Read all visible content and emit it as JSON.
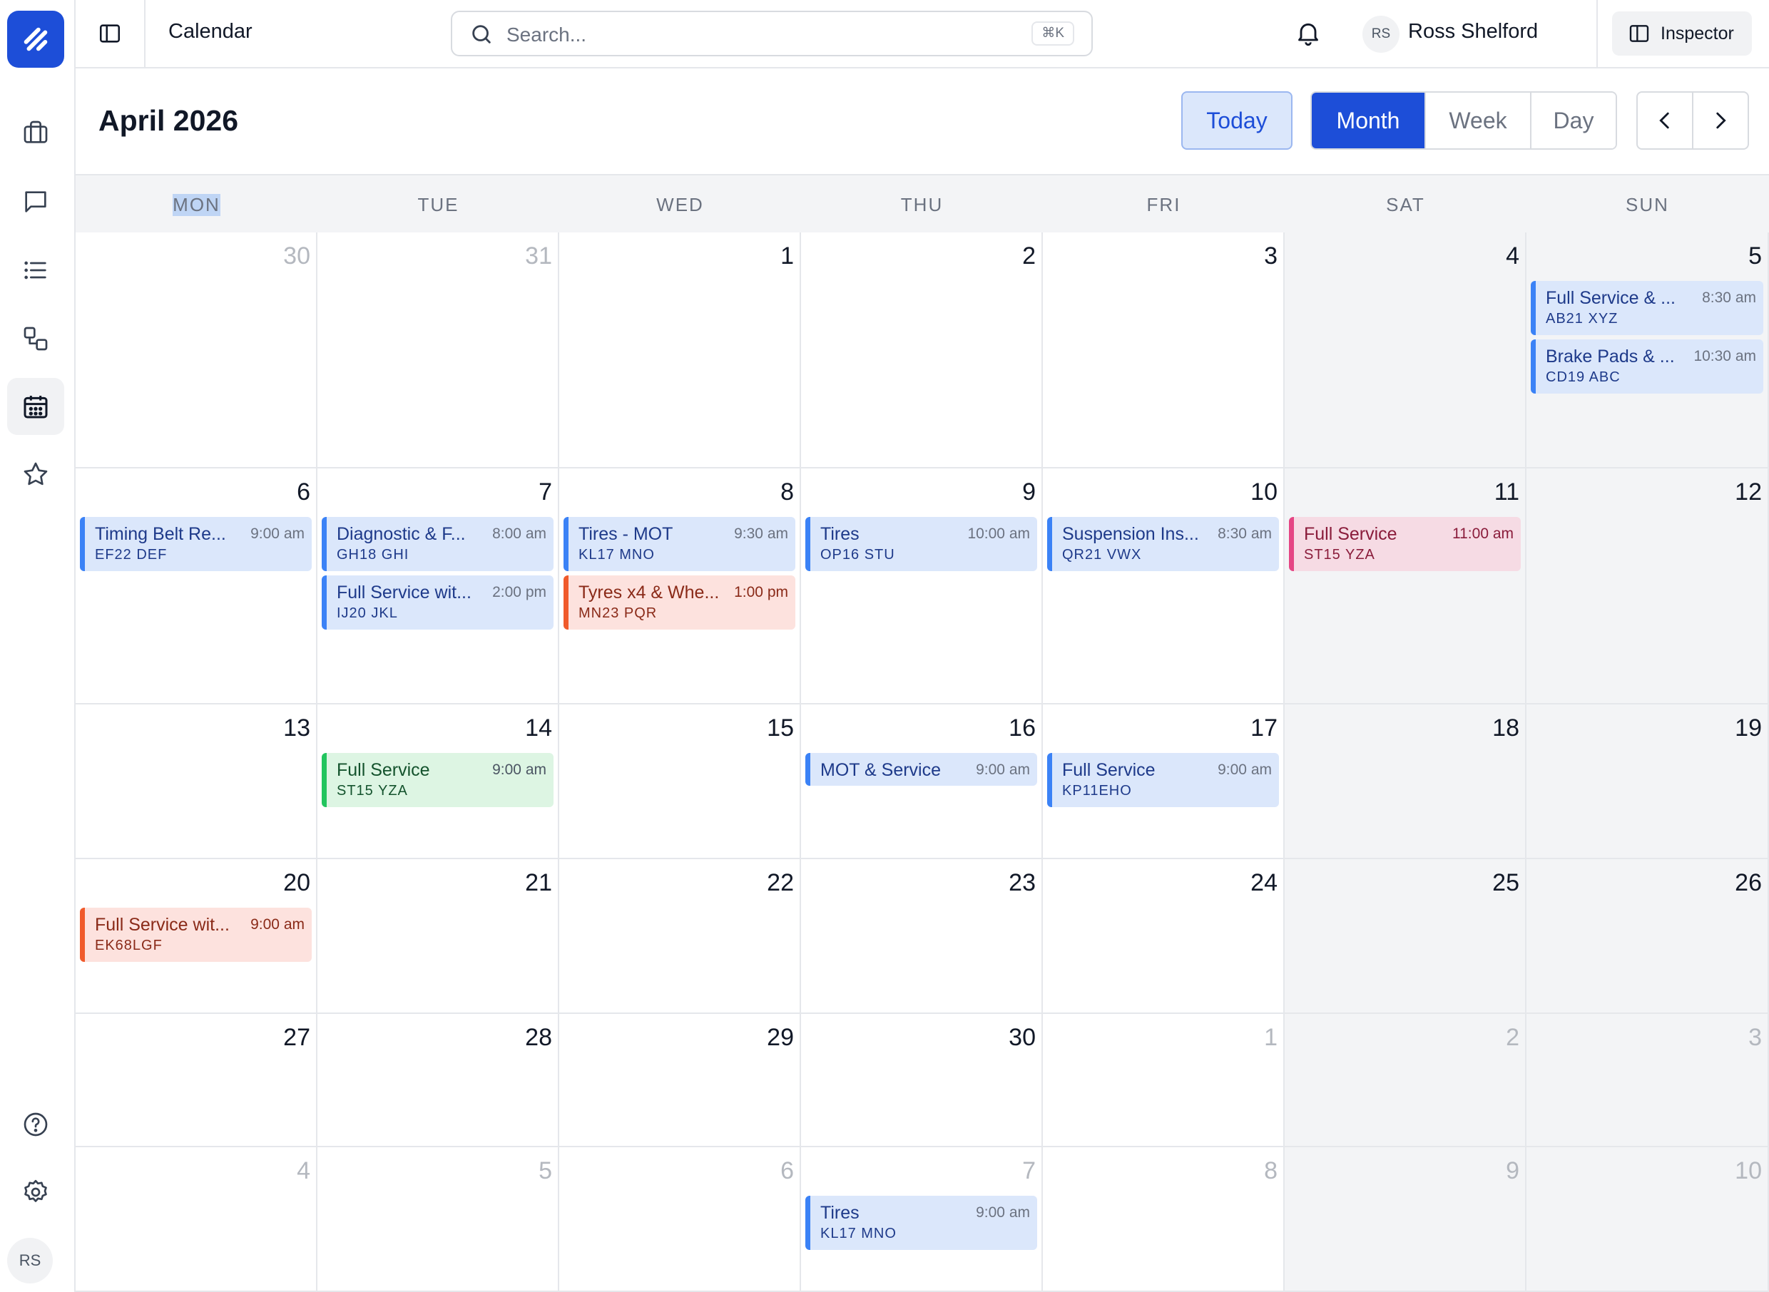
{
  "app": {
    "breadcrumb": "Calendar",
    "user_initials": "RS",
    "user_name": "Ross Shelford",
    "inspector_label": "Inspector",
    "search": {
      "placeholder": "Search...",
      "shortcut": "⌘K"
    }
  },
  "sidebar": {
    "items": [
      {
        "name": "briefcase-icon",
        "active": false
      },
      {
        "name": "message-icon",
        "active": false
      },
      {
        "name": "list-icon",
        "active": false
      },
      {
        "name": "workflow-icon",
        "active": false
      },
      {
        "name": "calendar-icon",
        "active": true
      },
      {
        "name": "star-icon",
        "active": false
      }
    ],
    "bottom": [
      "help-icon",
      "settings-icon"
    ],
    "avatar_initials": "RS"
  },
  "header": {
    "title": "April 2026",
    "today_label": "Today",
    "views": [
      {
        "label": "Month",
        "active": true
      },
      {
        "label": "Week",
        "active": false
      },
      {
        "label": "Day",
        "active": false
      }
    ]
  },
  "weekdays": [
    "MON",
    "TUE",
    "WED",
    "THU",
    "FRI",
    "SAT",
    "SUN"
  ],
  "colors": {
    "accent": "#1d4ed8",
    "blue": "#3b82f6",
    "orange": "#f05a2b",
    "pink": "#e54584",
    "green": "#22c55e"
  },
  "weeks": [
    [
      {
        "day": "30",
        "other": true,
        "events": []
      },
      {
        "day": "31",
        "other": true,
        "events": []
      },
      {
        "day": "1",
        "events": []
      },
      {
        "day": "2",
        "events": []
      },
      {
        "day": "3",
        "events": []
      },
      {
        "day": "4",
        "events": []
      },
      {
        "day": "5",
        "events": [
          {
            "title": "Full Service & ...",
            "time": "8:30 am",
            "plate": "AB21 XYZ",
            "color": "blue"
          },
          {
            "title": "Brake Pads & ...",
            "time": "10:30 am",
            "plate": "CD19 ABC",
            "color": "blue"
          }
        ]
      }
    ],
    [
      {
        "day": "6",
        "events": [
          {
            "title": "Timing Belt Re...",
            "time": "9:00 am",
            "plate": "EF22 DEF",
            "color": "blue"
          }
        ]
      },
      {
        "day": "7",
        "events": [
          {
            "title": "Diagnostic & F...",
            "time": "8:00 am",
            "plate": "GH18 GHI",
            "color": "blue"
          },
          {
            "title": "Full Service wit...",
            "time": "2:00 pm",
            "plate": "IJ20 JKL",
            "color": "blue"
          }
        ]
      },
      {
        "day": "8",
        "events": [
          {
            "title": "Tires - MOT",
            "time": "9:30 am",
            "plate": "KL17 MNO",
            "color": "blue"
          },
          {
            "title": "Tyres x4 & Whe...",
            "time": "1:00 pm",
            "plate": "MN23 PQR",
            "color": "orange"
          }
        ]
      },
      {
        "day": "9",
        "events": [
          {
            "title": "Tires",
            "time": "10:00 am",
            "plate": "OP16 STU",
            "color": "blue"
          }
        ]
      },
      {
        "day": "10",
        "events": [
          {
            "title": "Suspension Ins...",
            "time": "8:30 am",
            "plate": "QR21 VWX",
            "color": "blue"
          }
        ]
      },
      {
        "day": "11",
        "events": [
          {
            "title": "Full Service",
            "time": "11:00 am",
            "plate": "ST15 YZA",
            "color": "pink"
          }
        ]
      },
      {
        "day": "12",
        "events": []
      }
    ],
    [
      {
        "day": "13",
        "events": []
      },
      {
        "day": "14",
        "events": [
          {
            "title": "Full Service",
            "time": "9:00 am",
            "plate": "ST15 YZA",
            "color": "green"
          }
        ]
      },
      {
        "day": "15",
        "events": []
      },
      {
        "day": "16",
        "events": [
          {
            "title": "MOT & Service",
            "time": "9:00 am",
            "plate": "",
            "color": "blue"
          }
        ]
      },
      {
        "day": "17",
        "events": [
          {
            "title": "Full Service",
            "time": "9:00 am",
            "plate": "KP11EHO",
            "color": "blue"
          }
        ]
      },
      {
        "day": "18",
        "events": []
      },
      {
        "day": "19",
        "events": []
      }
    ],
    [
      {
        "day": "20",
        "events": [
          {
            "title": "Full Service wit...",
            "time": "9:00 am",
            "plate": "EK68LGF",
            "color": "orange"
          }
        ]
      },
      {
        "day": "21",
        "events": []
      },
      {
        "day": "22",
        "events": []
      },
      {
        "day": "23",
        "events": []
      },
      {
        "day": "24",
        "events": []
      },
      {
        "day": "25",
        "events": []
      },
      {
        "day": "26",
        "events": []
      }
    ],
    [
      {
        "day": "27",
        "events": []
      },
      {
        "day": "28",
        "events": []
      },
      {
        "day": "29",
        "events": []
      },
      {
        "day": "30",
        "events": []
      },
      {
        "day": "1",
        "other": true,
        "events": []
      },
      {
        "day": "2",
        "other": true,
        "events": []
      },
      {
        "day": "3",
        "other": true,
        "events": []
      }
    ],
    [
      {
        "day": "4",
        "other": true,
        "events": []
      },
      {
        "day": "5",
        "other": true,
        "events": []
      },
      {
        "day": "6",
        "other": true,
        "events": []
      },
      {
        "day": "7",
        "other": true,
        "events": [
          {
            "title": "Tires",
            "time": "9:00 am",
            "plate": "KL17 MNO",
            "color": "blue"
          }
        ]
      },
      {
        "day": "8",
        "other": true,
        "events": []
      },
      {
        "day": "9",
        "other": true,
        "events": []
      },
      {
        "day": "10",
        "other": true,
        "events": []
      }
    ]
  ]
}
